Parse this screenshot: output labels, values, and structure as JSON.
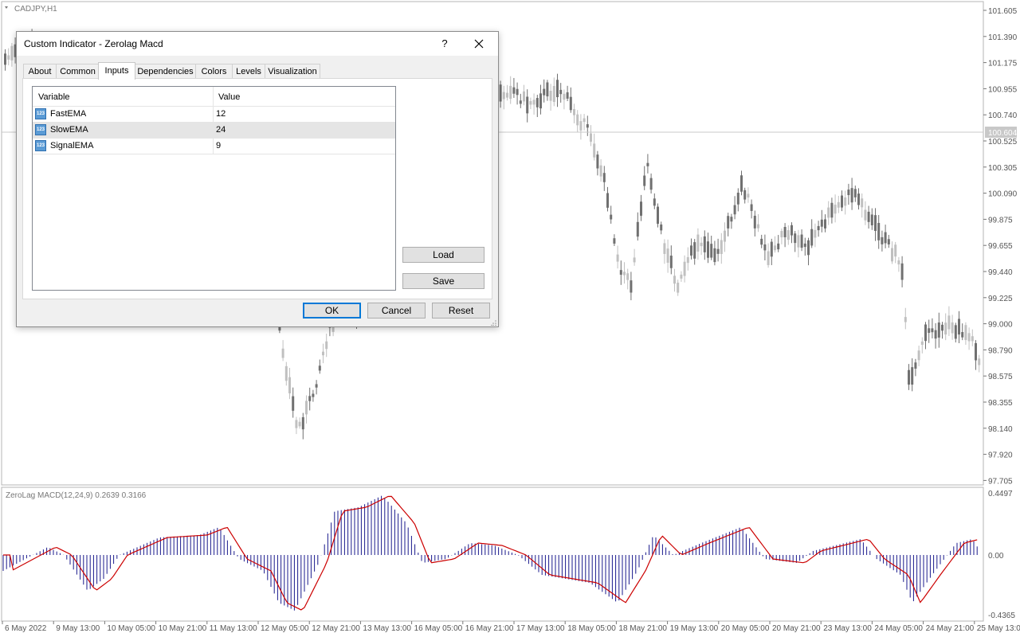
{
  "chart": {
    "symbol_label": "CADJPY,H1",
    "current_price": "100.604",
    "price_axis": [
      "101.605",
      "101.390",
      "101.175",
      "100.955",
      "100.740",
      "100.525",
      "100.305",
      "100.090",
      "99.875",
      "99.655",
      "99.440",
      "99.225",
      "99.000",
      "98.790",
      "98.575",
      "98.355",
      "98.140",
      "97.920",
      "97.705"
    ],
    "time_axis": [
      "6 May 2022",
      "9 May 13:00",
      "10 May 05:00",
      "10 May 21:00",
      "11 May 13:00",
      "12 May 05:00",
      "12 May 21:00",
      "13 May 13:00",
      "16 May 05:00",
      "16 May 21:00",
      "17 May 13:00",
      "18 May 05:00",
      "18 May 21:00",
      "19 May 13:00",
      "20 May 05:00",
      "20 May 21:00",
      "23 May 13:00",
      "24 May 05:00",
      "24 May 21:00",
      "25 May 13:00"
    ],
    "indicator_label": "ZeroLag MACD(12,24,9) 0.2639 0.3166",
    "indicator_axis": [
      "0.4497",
      "0.00",
      "-0.4365"
    ],
    "colors": {
      "bull_candle": "#c0c0c0",
      "bear_candle": "#707070",
      "histogram": "#1a1a8c",
      "signal_line": "#cc0000",
      "bid_line": "#c8c8c8"
    }
  },
  "dialog": {
    "title": "Custom Indicator - Zerolag Macd",
    "help_label": "?",
    "close_icon": "close-icon",
    "tabs": [
      "About",
      "Common",
      "Inputs",
      "Dependencies",
      "Colors",
      "Levels",
      "Visualization"
    ],
    "active_tab": "Inputs",
    "columns": {
      "variable": "Variable",
      "value": "Value"
    },
    "inputs": [
      {
        "name": "FastEMA",
        "value": "12",
        "icon": "number-123-icon",
        "icon_text": "123"
      },
      {
        "name": "SlowEMA",
        "value": "24",
        "icon": "number-123-icon",
        "icon_text": "123"
      },
      {
        "name": "SignalEMA",
        "value": "9",
        "icon": "number-123-icon",
        "icon_text": "123"
      }
    ],
    "selected_row": 1,
    "buttons": {
      "load": "Load",
      "save": "Save",
      "ok": "OK",
      "cancel": "Cancel",
      "reset": "Reset"
    }
  }
}
